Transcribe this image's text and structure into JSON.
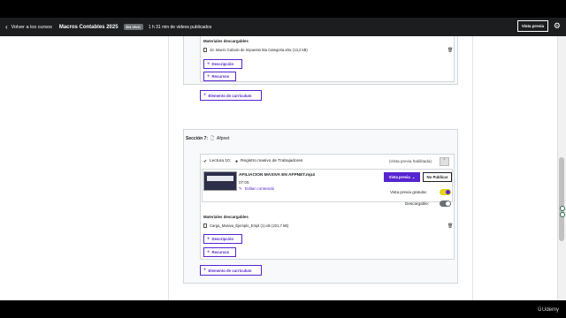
{
  "topbar": {
    "back_label": "Volver a los cursos",
    "course_title": "Macros Contables 2025",
    "status_badge": "EN VIVO",
    "duration_text": "1 h 31 min de videos publicados",
    "preview_label": "Vista previa"
  },
  "upper_section": {
    "materials_heading": "Materiales descargables",
    "file_name": "10. Macro Calculo de Impuesto 5ta Categoria.xlsx (13,2 kB)",
    "description_label": "Descripción",
    "resources_label": "Recursos"
  },
  "curriculum_item_label_1": "Elemento de currículum",
  "section7": {
    "section_label": "Sección 7:",
    "section_name": "Afpnet",
    "lecture_label": "Lectura 10:",
    "lecture_title": "Registro masivo de Trabajadores",
    "preview_enabled": "(Vista previa habilitada)",
    "video_title": "AFILIACION MASIVA EN AFPNET.mp4",
    "video_duration": "07:05",
    "edit_content": "Editar contenido",
    "preview_button": "Vista previa",
    "unpublish_button": "No Publicar",
    "free_preview_label": "Vista previa gratuita:",
    "free_preview_on": true,
    "downloadable_label": "Descargable:",
    "downloadable_on": false,
    "materials_heading": "Materiales descargables",
    "file_name": "Carga_Masiva_Ejemplo_Empl (1).xls (221,7 kB)",
    "description_label": "Descripción",
    "resources_label": "Recursos"
  },
  "curriculum_item_label_2": "Elemento de currículum",
  "footer": {
    "brand": "Udemy"
  },
  "colors": {
    "accent": "#5624d0",
    "dark_bar": "#1c1d1f",
    "toggle_on": "#e6d21a"
  }
}
